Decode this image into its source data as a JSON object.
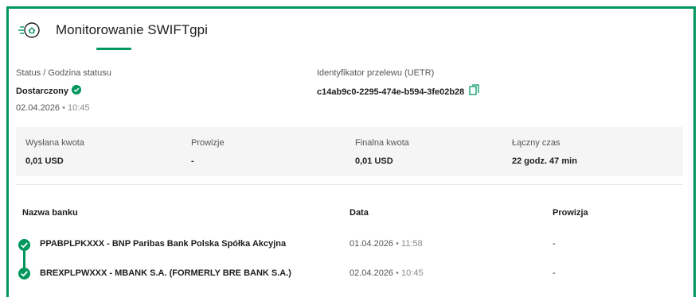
{
  "header": {
    "title": "Monitorowanie SWIFTgpi",
    "icon": "swift-transfer-icon",
    "accent_color": "#00965e"
  },
  "status": {
    "label": "Status / Godzina statusu",
    "value": "Dostarczony",
    "date": "02.04.2026",
    "separator": " • ",
    "time": "10:45"
  },
  "uetr": {
    "label": "Identyfikator przelewu (UETR)",
    "value": "c14ab9c0-2295-474e-b594-3fe02b28"
  },
  "summary": {
    "sent_label": "Wysłana kwota",
    "sent_value": "0,01 USD",
    "fees_label": "Prowizje",
    "fees_value": "-",
    "final_label": "Finalna kwota",
    "final_value": "0,01 USD",
    "total_time_label": "Łączny czas",
    "total_time_value": "22 godz. 47 min"
  },
  "table": {
    "headers": {
      "bank": "Nazwa banku",
      "date": "Data",
      "fee": "Prowizja"
    },
    "rows": [
      {
        "bank": "PPABPLPKXXX - BNP Paribas Bank Polska Spółka Akcyjna",
        "date": "01.04.2026",
        "sep": " • ",
        "time": "11:58",
        "fee": "-"
      },
      {
        "bank": "BREXPLPWXXX - MBANK S.A. (FORMERLY BRE BANK S.A.)",
        "date": "02.04.2026",
        "sep": " • ",
        "time": "10:45",
        "fee": "-"
      }
    ]
  }
}
